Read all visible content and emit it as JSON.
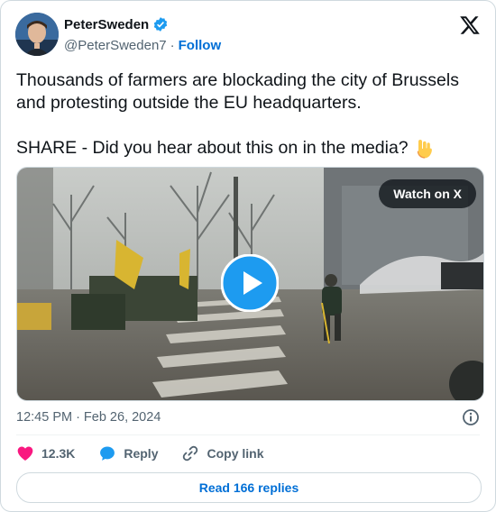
{
  "author": {
    "name": "PeterSweden",
    "handle": "@PeterSweden7",
    "separator": "·",
    "follow_label": "Follow"
  },
  "tweet": {
    "text_line1": "Thousands of farmers are blockading the city of Brussels and protesting outside the EU headquarters.",
    "text_line2": "SHARE - Did you hear about this on in the media?",
    "emoji": "point-down-emoji"
  },
  "media": {
    "watch_label": "Watch on X",
    "play_icon": "play-icon"
  },
  "meta": {
    "time": "12:45 PM",
    "separator": "·",
    "date": "Feb 26, 2024"
  },
  "actions": {
    "likes": "12.3K",
    "reply_label": "Reply",
    "copy_label": "Copy link"
  },
  "read_replies_label": "Read 166 replies",
  "colors": {
    "accent": "#1d9bf0",
    "like": "#f91880",
    "link": "#006fd6",
    "muted": "#536471"
  }
}
